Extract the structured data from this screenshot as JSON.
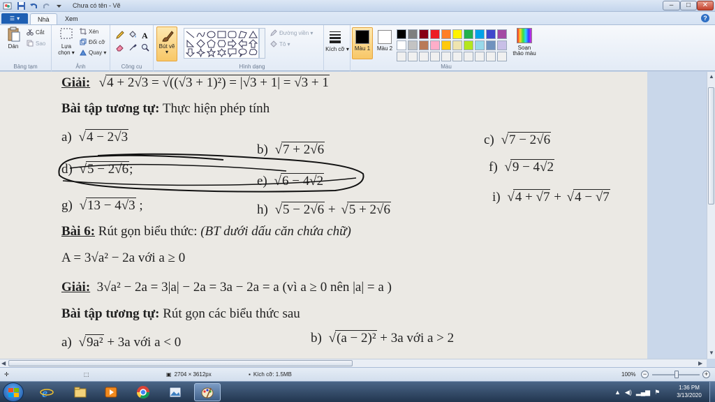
{
  "window": {
    "title": "Chưa có tên - Vẽ",
    "controls": {
      "minimize": "–",
      "maximize": "□",
      "close": "✕"
    }
  },
  "ribbon": {
    "file_menu_icon": "menu-icon",
    "tabs": [
      {
        "label": "Nhà",
        "active": true
      },
      {
        "label": "Xem",
        "active": false
      }
    ],
    "groups": {
      "clipboard": {
        "label": "Bảng tạm",
        "paste": "Dán",
        "cut": "Cắt",
        "copy": "Sao"
      },
      "image": {
        "label": "Ảnh",
        "select": "Lựa chọn ▾",
        "crop": "Xén",
        "resize": "Đổi cỡ",
        "rotate": "Quay ▾"
      },
      "tools": {
        "label": "Công cụ"
      },
      "brushes": {
        "label": "Bút vẽ ▾"
      },
      "shapes": {
        "label": "Hình dạng",
        "outline": "Đường viền ▾",
        "fill": "Tô ▾"
      },
      "size": {
        "label": "Kích cỡ ▾"
      },
      "colors": {
        "label": "Màu",
        "color1": "Màu 1",
        "color2": "Màu 2",
        "edit": "Soạn thảo màu"
      }
    },
    "colors": {
      "color1": "#000000",
      "color2": "#ffffff",
      "palette": [
        "#000000",
        "#7f7f7f",
        "#880015",
        "#ed1c24",
        "#ff7f27",
        "#fff200",
        "#22b14c",
        "#00a2e8",
        "#3f48cc",
        "#a349a4",
        "#ffffff",
        "#c3c3c3",
        "#b97a57",
        "#ffaec9",
        "#ffc90e",
        "#efe4b0",
        "#b5e61d",
        "#99d9ea",
        "#7092be",
        "#c8bfe7",
        "#f0f0f0",
        "#f0f0f0",
        "#f0f0f0",
        "#f0f0f0",
        "#f0f0f0",
        "#f0f0f0",
        "#f0f0f0",
        "#f0f0f0",
        "#f0f0f0",
        "#f0f0f0"
      ]
    }
  },
  "document": {
    "l1_head": "Giải:",
    "l1_expr": "4 + 2√3 = √((√3 + 1)²) = |√3 + 1| = √3 + 1",
    "l2_head": "Bài tập tương tự:",
    "l2_text": "Thực hiện phép tính",
    "a": "a)",
    "a_expr": "4 − 2√3",
    "b": "b)",
    "b_expr": "7 + 2√6",
    "c": "c)",
    "c_expr": "7 − 2√6",
    "d": "d)",
    "d_expr": "5 − 2√6",
    "d_tail": ";",
    "e": "e)",
    "e_expr": "6 − 4√2",
    "f": "f)",
    "f_expr": "9 − 4√2",
    "g": "g)",
    "g_expr": "13 − 4√3",
    "g_tail": ";",
    "h": "h)",
    "h_expr1": "5 − 2√6",
    "h_plus": "+",
    "h_expr2": "5 + 2√6",
    "i": "i)",
    "i_expr1": "4 + √7",
    "i_plus": "+",
    "i_expr2": "4 − √7",
    "b6_head": "Bài 6:",
    "b6_text": "Rút gọn biểu thức:",
    "b6_note": "(BT dưới dấu căn chứa chữ)",
    "eqA": "A = 3√a² − 2a  với a ≥ 0",
    "g2_head": "Giải:",
    "g2_expr": "3√a² − 2a = 3|a| − 2a = 3a − 2a = a (vì a ≥ 0 nên |a| = a )",
    "bt2_head": "Bài tập tương tự:",
    "bt2_text": "Rút gọn các biểu thức sau",
    "a2": "a)",
    "a2_expr": "9a²",
    "a2_tail": "+ 3a  với a < 0",
    "b2": "b)",
    "b2_expr": "(a − 2)²",
    "b2_tail": "+ 3a  với a > 2"
  },
  "status": {
    "add_icon": "plus-cursor-icon",
    "selection_icon": "selection-icon",
    "dimensions": "2704 × 3612px",
    "file_size": "Kích cỡ: 1.5MB",
    "zoom": "100%"
  },
  "taskbar": {
    "apps": [
      "internet-explorer",
      "file-explorer",
      "media-player",
      "chrome",
      "photos",
      "paint"
    ],
    "time": "1:36 PM",
    "date": "3/13/2020"
  }
}
